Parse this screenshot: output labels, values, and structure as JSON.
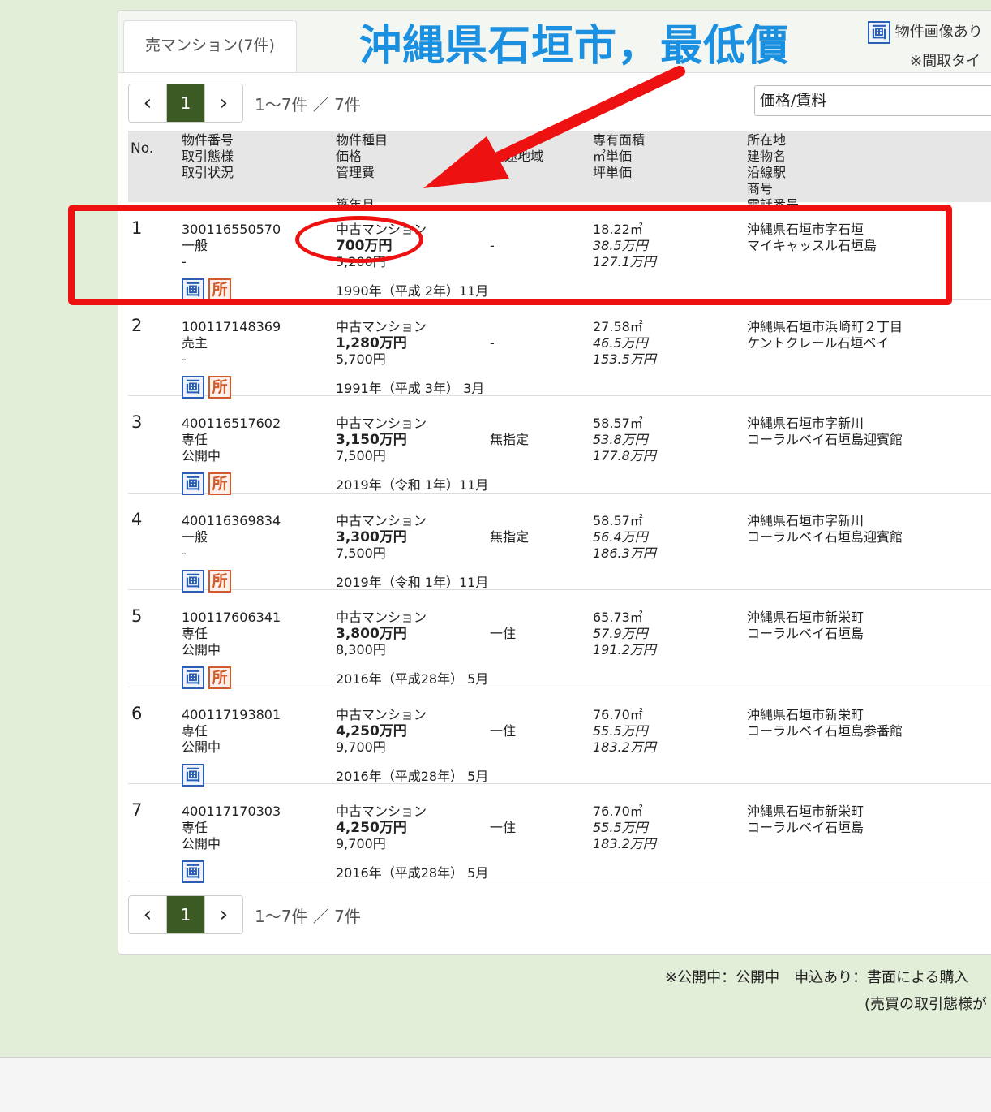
{
  "tab": {
    "label": "売マンション(7件)"
  },
  "annotation": {
    "headline": "沖縄県石垣市，最低價"
  },
  "legend": {
    "image_badge": "画",
    "image_text": "物件画像あり",
    "note": "※間取タイ"
  },
  "pager": {
    "prev": "‹",
    "current": "1",
    "next": "›",
    "info": "1〜7件 ／ 7件"
  },
  "sort": {
    "value": "価格/賃料"
  },
  "header": {
    "no": "No.",
    "col1": [
      "物件番号",
      "取引態様",
      "取引状況"
    ],
    "col2": [
      "物件種目",
      "価格",
      "管理費",
      "",
      "築年月"
    ],
    "col3": [
      "",
      "途地域"
    ],
    "col4": [
      "専有面積",
      "㎡単価",
      "坪単価"
    ],
    "col5": [
      "所在地",
      "建物名",
      "沿線駅",
      "商号",
      "電話番号"
    ]
  },
  "rows": [
    {
      "no": "1",
      "id": "300116550570",
      "mode": "一般",
      "status": "-",
      "type": "中古マンション",
      "price": "700万円",
      "fee": "5,200円",
      "zone": "-",
      "area": "18.22㎡",
      "sqm": "38.5万円",
      "tsubo": "127.1万円",
      "addr": "沖縄県石垣市字石垣",
      "name": "マイキャッスル石垣島",
      "built": "1990年（平成 2年）11月",
      "badges": [
        "画",
        "所"
      ]
    },
    {
      "no": "2",
      "id": "100117148369",
      "mode": "売主",
      "status": "-",
      "type": "中古マンション",
      "price": "1,280万円",
      "fee": "5,700円",
      "zone": "-",
      "area": "27.58㎡",
      "sqm": "46.5万円",
      "tsubo": "153.5万円",
      "addr": "沖縄県石垣市浜崎町２丁目",
      "name": "ケントクレール石垣ベイ",
      "built": "1991年（平成 3年） 3月",
      "badges": [
        "画",
        "所"
      ]
    },
    {
      "no": "3",
      "id": "400116517602",
      "mode": "専任",
      "status": "公開中",
      "type": "中古マンション",
      "price": "3,150万円",
      "fee": "7,500円",
      "zone": "無指定",
      "area": "58.57㎡",
      "sqm": "53.8万円",
      "tsubo": "177.8万円",
      "addr": "沖縄県石垣市字新川",
      "name": "コーラルベイ石垣島迎賓館",
      "built": "2019年（令和 1年）11月",
      "badges": [
        "画",
        "所"
      ]
    },
    {
      "no": "4",
      "id": "400116369834",
      "mode": "一般",
      "status": "-",
      "type": "中古マンション",
      "price": "3,300万円",
      "fee": "7,500円",
      "zone": "無指定",
      "area": "58.57㎡",
      "sqm": "56.4万円",
      "tsubo": "186.3万円",
      "addr": "沖縄県石垣市字新川",
      "name": "コーラルベイ石垣島迎賓館",
      "built": "2019年（令和 1年）11月",
      "badges": [
        "画",
        "所"
      ]
    },
    {
      "no": "5",
      "id": "100117606341",
      "mode": "専任",
      "status": "公開中",
      "type": "中古マンション",
      "price": "3,800万円",
      "fee": "8,300円",
      "zone": "一住",
      "area": "65.73㎡",
      "sqm": "57.9万円",
      "tsubo": "191.2万円",
      "addr": "沖縄県石垣市新栄町",
      "name": "コーラルベイ石垣島",
      "built": "2016年（平成28年） 5月",
      "badges": [
        "画",
        "所"
      ]
    },
    {
      "no": "6",
      "id": "400117193801",
      "mode": "専任",
      "status": "公開中",
      "type": "中古マンション",
      "price": "4,250万円",
      "fee": "9,700円",
      "zone": "一住",
      "area": "76.70㎡",
      "sqm": "55.5万円",
      "tsubo": "183.2万円",
      "addr": "沖縄県石垣市新栄町",
      "name": "コーラルベイ石垣島参番館",
      "built": "2016年（平成28年） 5月",
      "badges": [
        "画"
      ]
    },
    {
      "no": "7",
      "id": "400117170303",
      "mode": "専任",
      "status": "公開中",
      "type": "中古マンション",
      "price": "4,250万円",
      "fee": "9,700円",
      "zone": "一住",
      "area": "76.70㎡",
      "sqm": "55.5万円",
      "tsubo": "183.2万円",
      "addr": "沖縄県石垣市新栄町",
      "name": "コーラルベイ石垣島",
      "built": "2016年（平成28年） 5月",
      "badges": [
        "画"
      ]
    }
  ],
  "footer": {
    "note1": "※公開中：公開中　申込あり：書面による購入",
    "note2": "(売買の取引態様が"
  },
  "colors": {
    "accent": "#3b5a24",
    "annotation_red": "#ee1111",
    "headline_blue": "#1b90e0",
    "background": "#e3eed9"
  }
}
